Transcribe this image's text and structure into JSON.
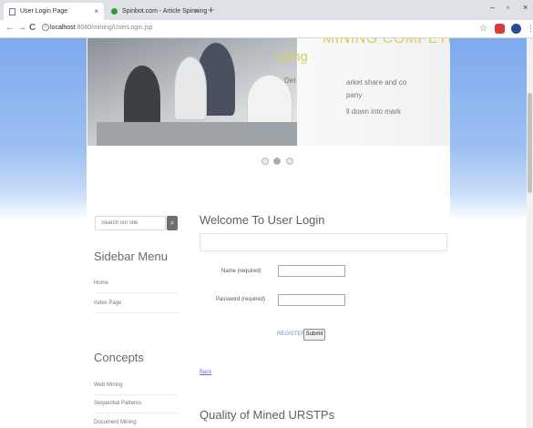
{
  "browser": {
    "tabs": [
      {
        "label": "User Login Page",
        "close": "×"
      },
      {
        "label": "Spinbot.com - Article Spinning",
        "close": "×"
      }
    ],
    "new_tab": "+",
    "window_controls": {
      "minimize": "–",
      "maximize": "▫",
      "close": "×"
    },
    "nav": {
      "back": "←",
      "forward": "→",
      "reload": "C"
    },
    "url_host": "localhost",
    "url_path": ":8080/mining/UserLogin.jsp",
    "bookmark": "☆",
    "menu": "⋮"
  },
  "slider": {
    "title": "MINING COMPETITIVE STR",
    "subtitle": "using",
    "lines": [
      "Det",
      "arket share and co",
      "pany",
      "ll down into mark"
    ],
    "dots": [
      false,
      true,
      false
    ]
  },
  "sidebar": {
    "search_placeholder": "Search our site",
    "search_icon": "magnifier-icon",
    "menu_heading": "Sidebar Menu",
    "menu_items": [
      "Home",
      "Index Page"
    ],
    "concepts_heading": "Concepts",
    "concepts_items": [
      "Web Mining",
      "Sequential Patterns",
      "Document Mining"
    ]
  },
  "main": {
    "title": "Welcome To User Login",
    "name_label": "Name (required)",
    "password_label": "Password (required)",
    "register_label": "REGISTER",
    "submit_label": "Submit",
    "back_label": "Back",
    "section_title": "Quality of Mined URSTPs"
  },
  "colors": {
    "sky_blue": "#7fa9ec",
    "slide_text": "#d8cf5a",
    "link_blue": "#6a8fd0"
  }
}
